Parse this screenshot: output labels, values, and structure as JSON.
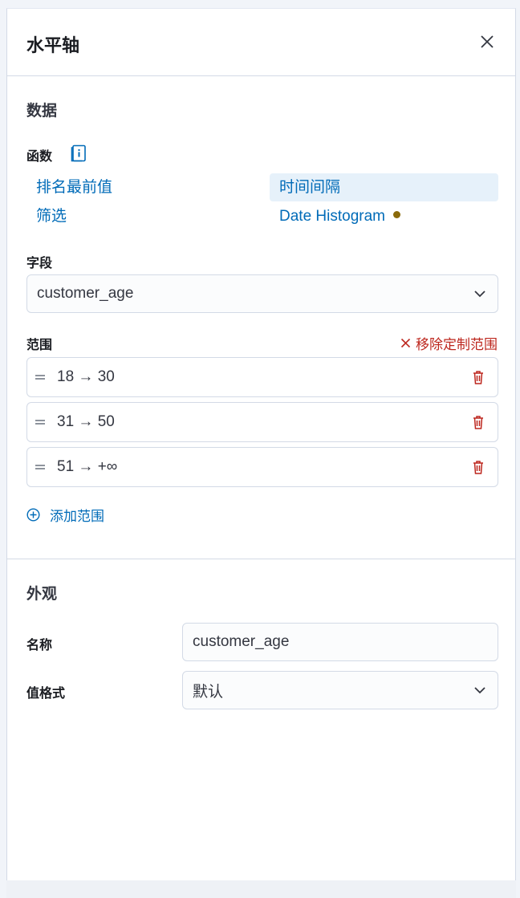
{
  "panel": {
    "title": "水平轴"
  },
  "data_section": {
    "title": "数据",
    "function_label": "函数",
    "functions": [
      {
        "label": "排名最前值"
      },
      {
        "label": "筛选"
      },
      {
        "label": "时间间隔",
        "selected": true
      },
      {
        "label": "Date Histogram"
      }
    ],
    "field_label": "字段",
    "field_value": "customer_age",
    "ranges_label": "范围",
    "remove_custom_ranges": "移除定制范围",
    "ranges": [
      {
        "label": "18 → 30"
      },
      {
        "label": "31 → 50"
      },
      {
        "label": "51 → +∞"
      }
    ],
    "add_range": "添加范围"
  },
  "appearance_section": {
    "title": "外观",
    "name_label": "名称",
    "name_value": "customer_age",
    "format_label": "值格式",
    "format_value": "默认"
  },
  "colors": {
    "link": "#006bb8",
    "danger": "#bd271e",
    "selected_bg": "#e6f1fa",
    "warning_dot": "#8a6a0a"
  },
  "icons": [
    "close-icon",
    "documentation-icon",
    "chevron-down-icon",
    "drag-handle-icon",
    "trash-icon",
    "plus-circle-icon",
    "cross-icon"
  ]
}
